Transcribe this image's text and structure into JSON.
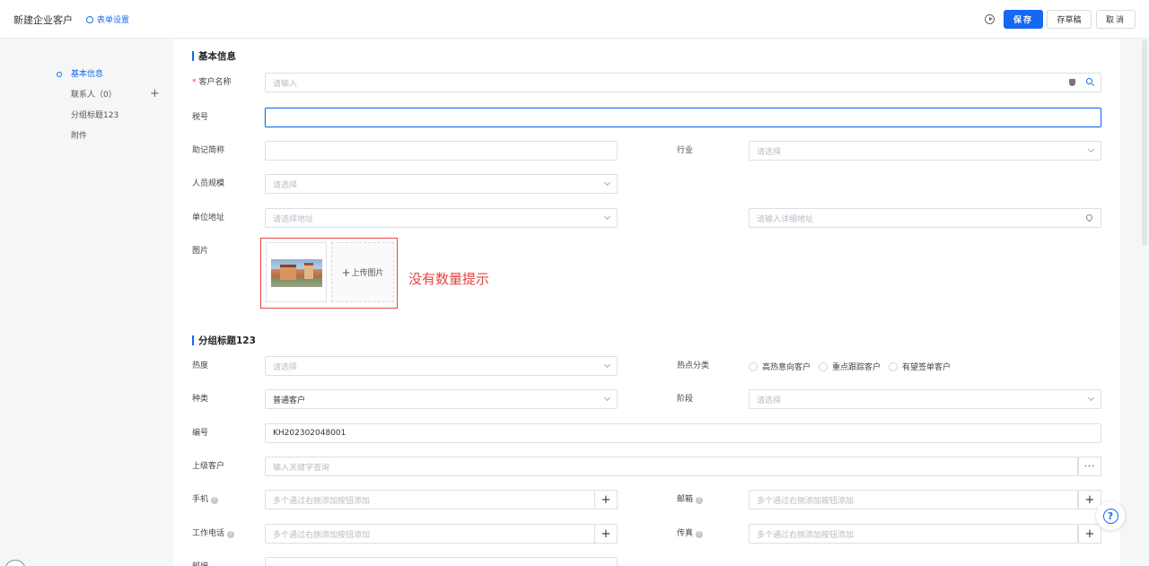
{
  "header": {
    "title": "新建企业客户",
    "form_settings": "表单设置",
    "save": "保存",
    "draft": "存草稿",
    "cancel": "取消"
  },
  "nav": {
    "items": [
      {
        "label": "基本信息",
        "active": true
      },
      {
        "label": "联系人（0）"
      },
      {
        "label": "分组标题123"
      },
      {
        "label": "附件"
      }
    ]
  },
  "basic": {
    "title": "基本信息",
    "customer_name": {
      "label": "客户名称",
      "placeholder": "请输入",
      "required": true
    },
    "tax_no": {
      "label": "税号",
      "value": ""
    },
    "mnemonic": {
      "label": "助记简称",
      "value": ""
    },
    "industry": {
      "label": "行业",
      "placeholder": "请选择"
    },
    "staff_size": {
      "label": "人员规模",
      "placeholder": "请选择"
    },
    "address": {
      "label": "单位地址",
      "placeholder": "请选择地址",
      "detail_placeholder": "请输入详细地址"
    },
    "image": {
      "label": "图片",
      "upload": "上传图片"
    },
    "annotation": "没有数量提示"
  },
  "group": {
    "title": "分组标题123",
    "heat": {
      "label": "热度",
      "placeholder": "请选择"
    },
    "hot_category": {
      "label": "热点分类",
      "options": [
        "高热意向客户",
        "重点跟踪客户",
        "有望签单客户"
      ]
    },
    "kind": {
      "label": "种类",
      "value": "普通客户"
    },
    "stage": {
      "label": "阶段",
      "placeholder": "请选择"
    },
    "code": {
      "label": "编号",
      "value": "KH202302048001"
    },
    "parent": {
      "label": "上级客户",
      "placeholder": "输入关键字查询",
      "more": "···"
    },
    "mobile": {
      "label": "手机",
      "placeholder": "多个通过右侧添加按钮添加"
    },
    "email": {
      "label": "邮箱",
      "placeholder": "多个通过右侧添加按钮添加"
    },
    "work_phone": {
      "label": "工作电话",
      "placeholder": "多个通过右侧添加按钮添加"
    },
    "fax": {
      "label": "传真",
      "placeholder": "多个通过右侧添加按钮添加"
    },
    "postcode": {
      "label": "邮编"
    }
  },
  "help": "?"
}
